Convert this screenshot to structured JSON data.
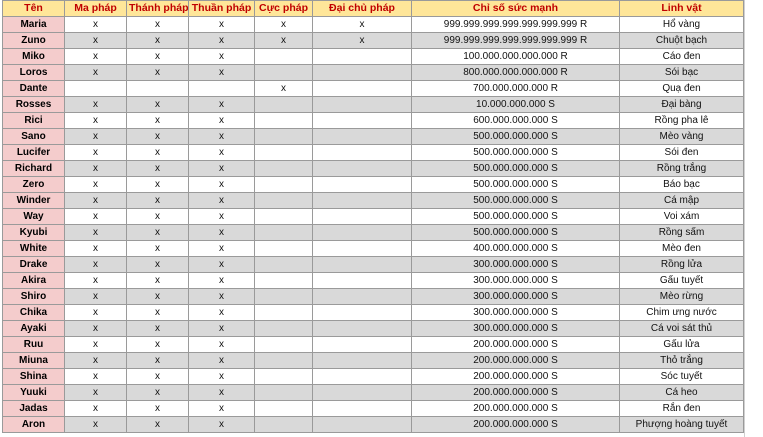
{
  "headers": [
    "Tên",
    "Ma pháp",
    "Thánh pháp",
    "Thuần pháp",
    "Cực pháp",
    "Đại chủ pháp",
    "Chỉ số sức mạnh",
    "Linh vật"
  ],
  "rows": [
    {
      "name": "Maria",
      "marks": [
        "x",
        "x",
        "x",
        "x",
        "x"
      ],
      "power": "999.999.999.999.999.999.999 R",
      "pet": "Hổ vàng"
    },
    {
      "name": "Zuno",
      "marks": [
        "x",
        "x",
        "x",
        "x",
        "x"
      ],
      "power": "999.999.999.999.999.999.999 R",
      "pet": "Chuột bạch"
    },
    {
      "name": "Miko",
      "marks": [
        "x",
        "x",
        "x",
        "",
        ""
      ],
      "power": "100.000.000.000.000 R",
      "pet": "Cáo đen"
    },
    {
      "name": "Loros",
      "marks": [
        "x",
        "x",
        "x",
        "",
        ""
      ],
      "power": "800.000.000.000.000 R",
      "pet": "Sói bạc"
    },
    {
      "name": "Dante",
      "marks": [
        "",
        "",
        "",
        "x",
        ""
      ],
      "power": "700.000.000.000 R",
      "pet": "Quạ đen"
    },
    {
      "name": "Rosses",
      "marks": [
        "x",
        "x",
        "x",
        "",
        ""
      ],
      "power": "10.000.000.000 S",
      "pet": "Đại bàng"
    },
    {
      "name": "Rici",
      "marks": [
        "x",
        "x",
        "x",
        "",
        ""
      ],
      "power": "600.000.000.000 S",
      "pet": "Rồng pha lê"
    },
    {
      "name": "Sano",
      "marks": [
        "x",
        "x",
        "x",
        "",
        ""
      ],
      "power": "500.000.000.000 S",
      "pet": "Mèo vàng"
    },
    {
      "name": "Lucifer",
      "marks": [
        "x",
        "x",
        "x",
        "",
        ""
      ],
      "power": "500.000.000.000 S",
      "pet": "Sói đen"
    },
    {
      "name": "Richard",
      "marks": [
        "x",
        "x",
        "x",
        "",
        ""
      ],
      "power": "500.000.000.000 S",
      "pet": "Rồng trắng"
    },
    {
      "name": "Zero",
      "marks": [
        "x",
        "x",
        "x",
        "",
        ""
      ],
      "power": "500.000.000.000 S",
      "pet": "Báo bạc"
    },
    {
      "name": "Winder",
      "marks": [
        "x",
        "x",
        "x",
        "",
        ""
      ],
      "power": "500.000.000.000 S",
      "pet": "Cá mập"
    },
    {
      "name": "Way",
      "marks": [
        "x",
        "x",
        "x",
        "",
        ""
      ],
      "power": "500.000.000.000 S",
      "pet": "Voi xám"
    },
    {
      "name": "Kyubi",
      "marks": [
        "x",
        "x",
        "x",
        "",
        ""
      ],
      "power": "500.000.000.000 S",
      "pet": "Rồng sấm"
    },
    {
      "name": "White",
      "marks": [
        "x",
        "x",
        "x",
        "",
        ""
      ],
      "power": "400.000.000.000 S",
      "pet": "Mèo đen"
    },
    {
      "name": "Drake",
      "marks": [
        "x",
        "x",
        "x",
        "",
        ""
      ],
      "power": "300.000.000.000 S",
      "pet": "Rồng lửa"
    },
    {
      "name": "Akira",
      "marks": [
        "x",
        "x",
        "x",
        "",
        ""
      ],
      "power": "300.000.000.000 S",
      "pet": "Gấu tuyết"
    },
    {
      "name": "Shiro",
      "marks": [
        "x",
        "x",
        "x",
        "",
        ""
      ],
      "power": "300.000.000.000 S",
      "pet": "Mèo rừng"
    },
    {
      "name": "Chika",
      "marks": [
        "x",
        "x",
        "x",
        "",
        ""
      ],
      "power": "300.000.000.000 S",
      "pet": "Chim ưng nước"
    },
    {
      "name": "Ayaki",
      "marks": [
        "x",
        "x",
        "x",
        "",
        ""
      ],
      "power": "300.000.000.000 S",
      "pet": "Cá voi sát thủ"
    },
    {
      "name": "Ruu",
      "marks": [
        "x",
        "x",
        "x",
        "",
        ""
      ],
      "power": "200.000.000.000 S",
      "pet": "Gấu lửa"
    },
    {
      "name": "Miuna",
      "marks": [
        "x",
        "x",
        "x",
        "",
        ""
      ],
      "power": "200.000.000.000 S",
      "pet": "Thỏ trắng"
    },
    {
      "name": "Shina",
      "marks": [
        "x",
        "x",
        "x",
        "",
        ""
      ],
      "power": "200.000.000.000 S",
      "pet": "Sóc tuyết"
    },
    {
      "name": "Yuuki",
      "marks": [
        "x",
        "x",
        "x",
        "",
        ""
      ],
      "power": "200.000.000.000 S",
      "pet": "Cá heo"
    },
    {
      "name": "Jadas",
      "marks": [
        "x",
        "x",
        "x",
        "",
        ""
      ],
      "power": "200.000.000.000 S",
      "pet": "Rắn đen"
    },
    {
      "name": "Aron",
      "marks": [
        "x",
        "x",
        "x",
        "",
        ""
      ],
      "power": "200.000.000.000 S",
      "pet": "Phượng hoàng tuyết"
    }
  ],
  "colors": {
    "header_bg": "#ffe699",
    "header_text": "#c00000",
    "name_bg": "#f4cccc",
    "shade_bg": "#d9d9d9",
    "grid_line": "#9a9a9a"
  }
}
